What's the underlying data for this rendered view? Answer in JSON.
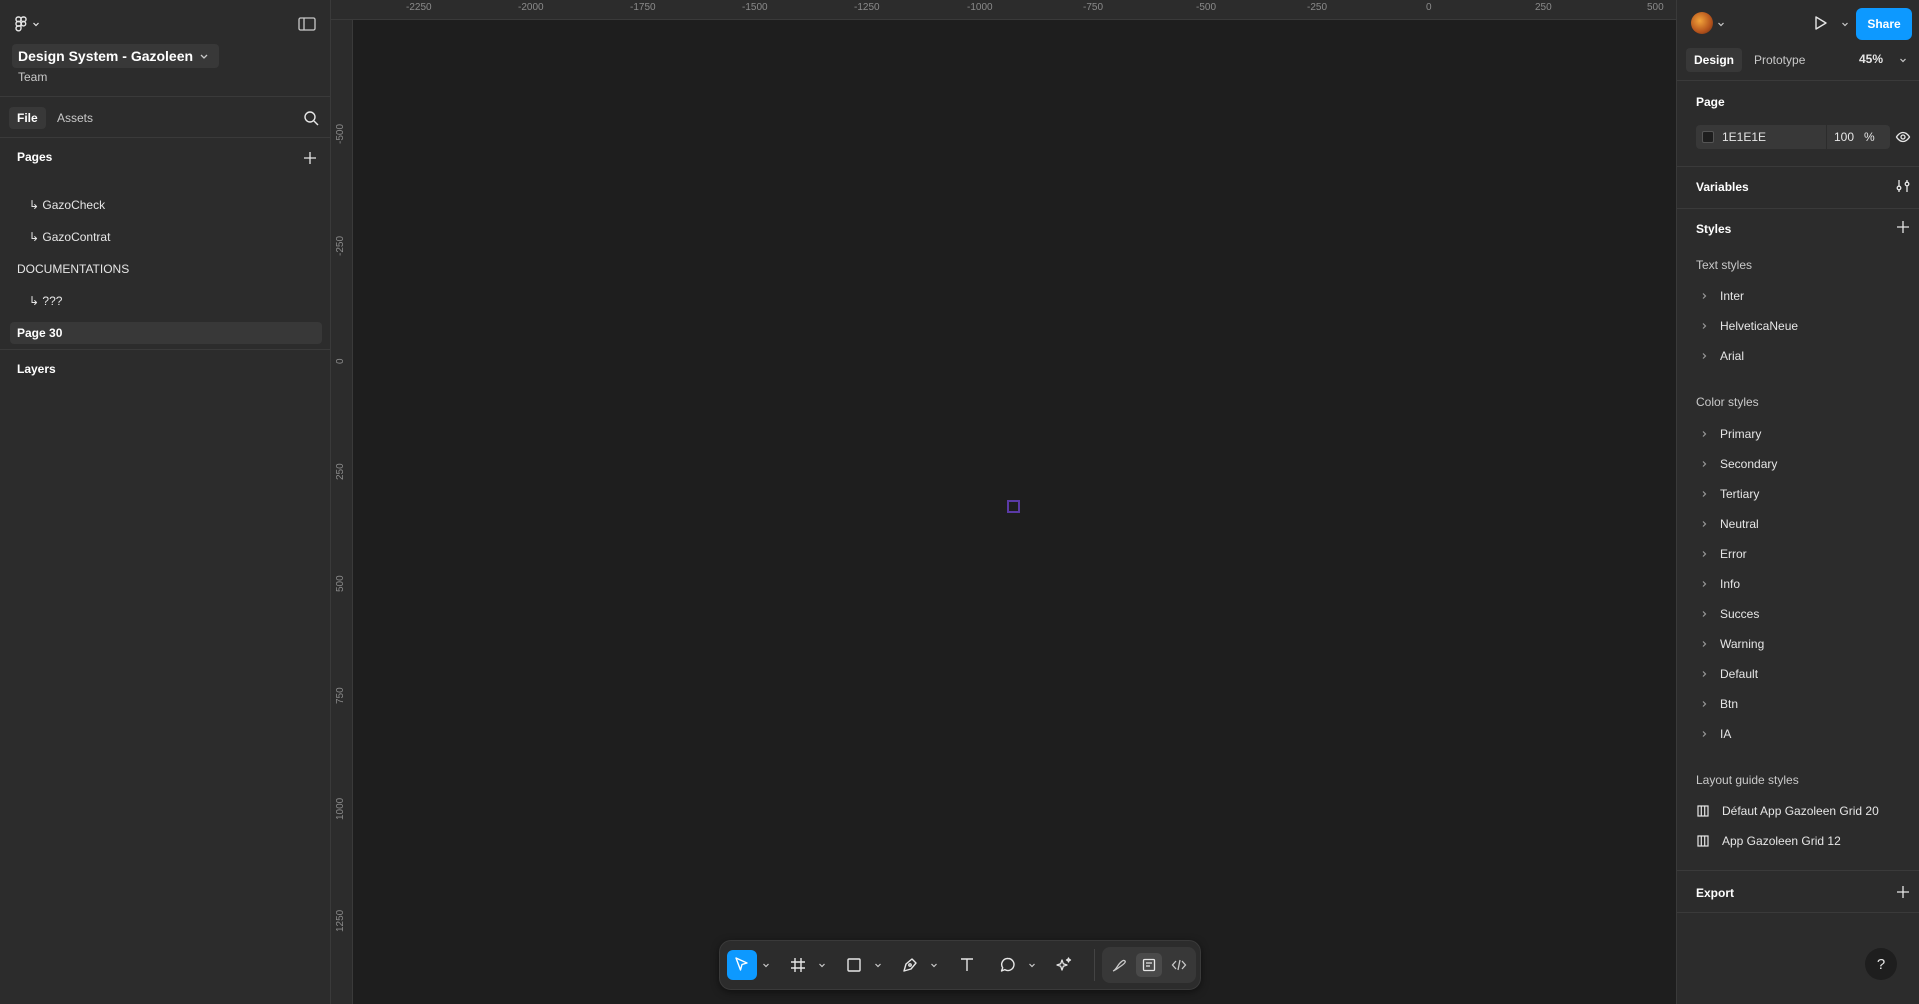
{
  "file": {
    "name": "Design System - Gazoleen",
    "team": "Team"
  },
  "left_tabs": {
    "file": "File",
    "assets": "Assets"
  },
  "pages": {
    "header": "Pages",
    "items": [
      {
        "label": "↳ GazoCheck"
      },
      {
        "label": "↳ GazoContrat"
      },
      {
        "label": "DOCUMENTATIONS"
      },
      {
        "label": "↳ ???"
      },
      {
        "label": "Page 30"
      }
    ]
  },
  "layers": {
    "header": "Layers"
  },
  "rulers": {
    "top": [
      "-2250",
      "-2000",
      "-1750",
      "-1500",
      "-1250",
      "-1000",
      "-750",
      "-500",
      "-250",
      "0",
      "250",
      "500"
    ],
    "left": [
      "-500",
      "-250",
      "0",
      "250",
      "500",
      "750",
      "1000",
      "1250"
    ]
  },
  "toolbar": {
    "tools": [
      "move-tool",
      "frame-tool",
      "shape-tool",
      "pen-tool",
      "text-tool",
      "comment-tool",
      "actions-tool"
    ],
    "modes": [
      "draw-mode",
      "design-mode",
      "dev-mode"
    ],
    "active_tool": "move-tool",
    "active_mode": "design-mode"
  },
  "right": {
    "share": "Share",
    "tabs": {
      "design": "Design",
      "prototype": "Prototype"
    },
    "zoom": "45%",
    "page": {
      "title": "Page",
      "color": "1E1E1E",
      "opacity": "100",
      "pct": "%"
    },
    "variables": "Variables",
    "styles": {
      "title": "Styles",
      "text_title": "Text styles",
      "text": [
        "Inter",
        "HelveticaNeue",
        "Arial"
      ],
      "color_title": "Color styles",
      "color": [
        "Primary",
        "Secondary",
        "Tertiary",
        "Neutral",
        "Error",
        "Info",
        "Succes",
        "Warning",
        "Default",
        "Btn",
        "IA"
      ],
      "grid_title": "Layout guide styles",
      "grid": [
        "Défaut App Gazoleen Grid 20",
        "App Gazoleen Grid 12"
      ]
    },
    "export": "Export",
    "help": "?"
  },
  "colors": {
    "accent": "#0d99ff",
    "canvas": "#1e1e1e",
    "panel": "#2c2c2c",
    "frame_outline": "#5a3aa6"
  }
}
